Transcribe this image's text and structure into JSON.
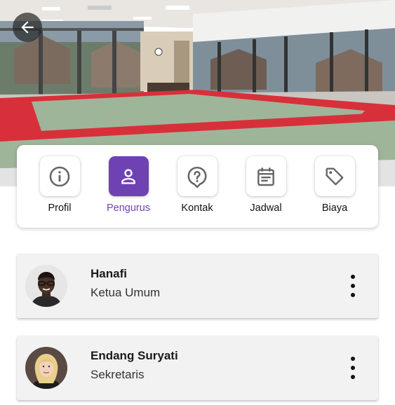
{
  "header": {
    "back_icon": "arrow-left-icon",
    "hero_image": "dojo-training-hall-photo"
  },
  "tabs": [
    {
      "label": "Profil",
      "icon": "info-circle-icon",
      "active": false
    },
    {
      "label": "Pengurus",
      "icon": "person-icon",
      "active": true
    },
    {
      "label": "Kontak",
      "icon": "question-bubble-icon",
      "active": false
    },
    {
      "label": "Jadwal",
      "icon": "calendar-icon",
      "active": false
    },
    {
      "label": "Biaya",
      "icon": "tag-icon",
      "active": false
    }
  ],
  "members": [
    {
      "name": "Hanafi",
      "role": "Ketua Umum",
      "avatar": "avatar-man-photo",
      "menu_icon": "more-vertical-icon"
    },
    {
      "name": "Endang Suryati",
      "role": "Sekretaris",
      "avatar": "avatar-woman-photo",
      "menu_icon": "more-vertical-icon"
    }
  ],
  "colors": {
    "accent": "#6f42b3",
    "card_bg": "#f2f2f2",
    "mat_red": "#d8303a",
    "mat_green": "#9fb59a"
  }
}
